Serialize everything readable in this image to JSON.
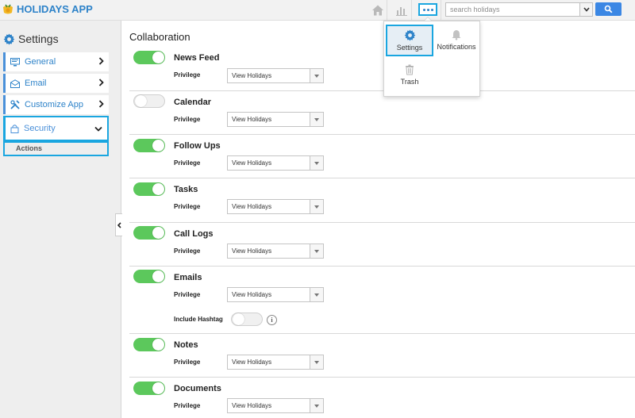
{
  "app": {
    "title": "HOLIDAYS APP"
  },
  "topbar": {
    "search_placeholder": "search holidays",
    "icons": [
      "home-icon",
      "bar-chart-icon",
      "more-icon",
      "search-icon"
    ]
  },
  "menu": {
    "settings": "Settings",
    "notifications": "Notifications",
    "trash": "Trash"
  },
  "sidebar": {
    "title": "Settings",
    "items": [
      {
        "label": "General"
      },
      {
        "label": "Email"
      },
      {
        "label": "Customize App"
      },
      {
        "label": "Security"
      }
    ],
    "sub_item": "Actions"
  },
  "main": {
    "title": "Collaboration",
    "privilege_label": "Privilege",
    "hashtag_label": "Include Hashtag",
    "info_symbol": "i",
    "rows": [
      {
        "title": "News Feed",
        "enabled": true,
        "privilege": "View Holidays"
      },
      {
        "title": "Calendar",
        "enabled": false,
        "privilege": "View Holidays"
      },
      {
        "title": "Follow Ups",
        "enabled": true,
        "privilege": "View Holidays"
      },
      {
        "title": "Tasks",
        "enabled": true,
        "privilege": "View Holidays"
      },
      {
        "title": "Call Logs",
        "enabled": true,
        "privilege": "View Holidays"
      },
      {
        "title": "Emails",
        "enabled": true,
        "privilege": "View Holidays"
      },
      {
        "title": "Notes",
        "enabled": true,
        "privilege": "View Holidays"
      },
      {
        "title": "Documents",
        "enabled": true,
        "privilege": "View Holidays"
      }
    ]
  },
  "colors": {
    "accent": "#2e83c9",
    "highlight": "#1aa6e0",
    "toggle_on": "#5cc85c",
    "search_button": "#3b87e4"
  }
}
